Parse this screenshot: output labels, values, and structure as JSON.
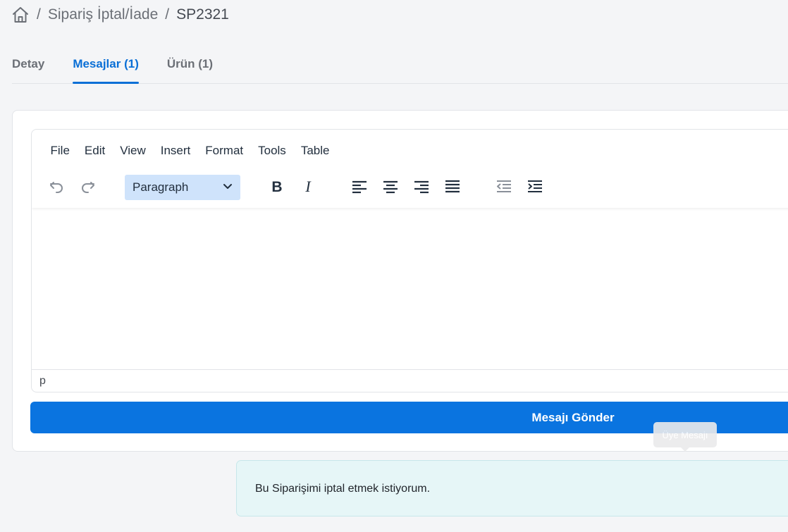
{
  "breadcrumb": {
    "home_icon": "home-icon",
    "items": [
      "Sipariş İptal/İade",
      "SP2321"
    ],
    "separator": "/"
  },
  "tabs": [
    {
      "label": "Detay",
      "active": false
    },
    {
      "label": "Mesajlar (1)",
      "active": true
    },
    {
      "label": "Ürün (1)",
      "active": false
    }
  ],
  "editor": {
    "menu": [
      "File",
      "Edit",
      "View",
      "Insert",
      "Format",
      "Tools",
      "Table"
    ],
    "toolbar": {
      "icons": [
        "undo-icon",
        "redo-icon",
        "bold-icon",
        "italic-icon",
        "align-left-icon",
        "align-center-icon",
        "align-right-icon",
        "align-justify-icon",
        "outdent-icon",
        "indent-icon"
      ],
      "block_format": "Paragraph"
    },
    "statusbar_path": "p",
    "content": ""
  },
  "send_button": {
    "label": "Mesajı Gönder"
  },
  "tooltip": {
    "label": "Üye Mesajı"
  },
  "messages": [
    {
      "text": "Bu Siparişimi iptal etmek istiyorum."
    }
  ],
  "colors": {
    "accent": "#0a74e0",
    "active_tab": "#0a6fd6",
    "message_bg": "#e6f6f7",
    "select_bg": "#cfe3fb"
  }
}
